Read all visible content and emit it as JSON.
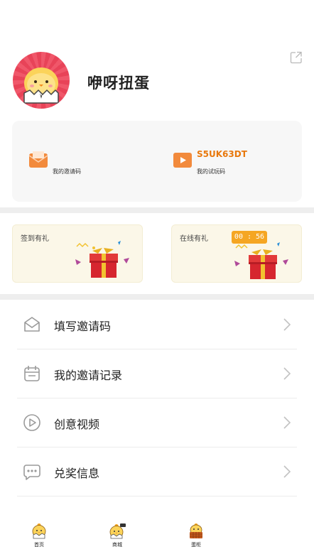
{
  "profile": {
    "username": "咿呀扭蛋",
    "avatar_icon": "chick-avatar-icon",
    "share_icon": "share-icon"
  },
  "codes": {
    "invite": {
      "value": "",
      "label": "我的邀请码",
      "icon": "envelope-icon"
    },
    "trial": {
      "value": "S5UK63DT",
      "label": "我的试玩码",
      "icon": "video-icon"
    }
  },
  "gifts": {
    "signin": {
      "title": "签到有礼"
    },
    "online": {
      "title": "在线有礼",
      "timer": "00 : 56"
    }
  },
  "menu": [
    {
      "label": "填写邀请码",
      "icon": "mail-icon"
    },
    {
      "label": "我的邀请记录",
      "icon": "calendar-icon"
    },
    {
      "label": "创意视频",
      "icon": "play-icon"
    },
    {
      "label": "兑奖信息",
      "icon": "chat-icon"
    }
  ],
  "tabbar": [
    {
      "label": "首页"
    },
    {
      "label": "商城"
    },
    {
      "label": "蛋柜"
    }
  ],
  "colors": {
    "accent": "#e8780c",
    "timer_bg": "#f5a623",
    "avatar_bg": "#e84358"
  }
}
